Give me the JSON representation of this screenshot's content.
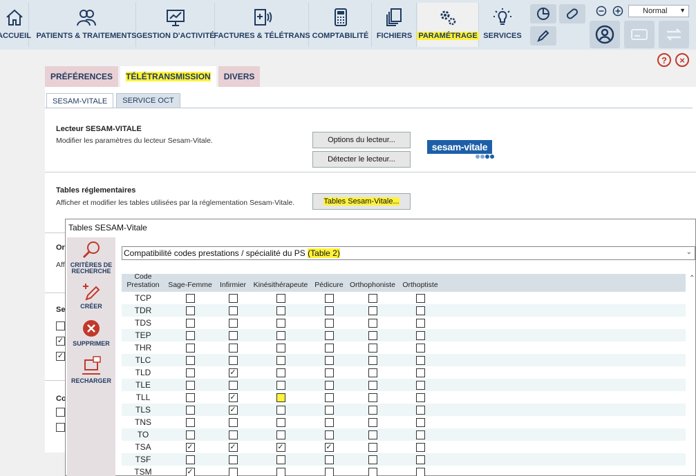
{
  "nav": {
    "items": [
      {
        "id": "accueil",
        "label": "ACCUEIL"
      },
      {
        "id": "patients",
        "label": "PATIENTS & TRAITEMENTS"
      },
      {
        "id": "gestion",
        "label": "GESTION D'ACTIVITÉ"
      },
      {
        "id": "factures",
        "label": "FACTURES & TÉLÉTRANS"
      },
      {
        "id": "comptabilite",
        "label": "COMPTABILITÉ"
      },
      {
        "id": "fichiers",
        "label": "FICHIERS"
      },
      {
        "id": "parametrage",
        "label": "PARAMÉTRAGE"
      },
      {
        "id": "services",
        "label": "SERVICES"
      }
    ],
    "mode": "Normal"
  },
  "tabs": {
    "main": [
      "PRÉFÉRENCES",
      "TÉLÉTRANSMISSION",
      "DIVERS"
    ],
    "sub": [
      "SESAM-VITALE",
      "SERVICE OCT"
    ]
  },
  "reader": {
    "title": "Lecteur SESAM-VITALE",
    "desc": "Modifier les paramètres du lecteur Sesam-Vitale.",
    "btn_options": "Options du lecteur...",
    "btn_detect": "Détecter le lecteur..."
  },
  "logo_text": "sesam-vitale",
  "tables": {
    "title": "Tables réglementaires",
    "desc": "Afficher et modifier les tables utilisées par la réglementation Sesam-Vitale.",
    "btn": "Tables Sesam-Vitale..."
  },
  "bg_partial": {
    "s1": "Or",
    "s1d": "Affi",
    "s2": "Se",
    "s3": "Co"
  },
  "dialog": {
    "title": "Tables SESAM-Vitale",
    "side": {
      "criteria": "CRITÈRES DE RECHERCHE",
      "create": "CRÉER",
      "delete": "SUPPRIMER",
      "reload": "RECHARGER"
    },
    "combo_prefix": "Compatibilité codes prestations / spécialité du PS",
    "combo_suffix": "(Table 2)"
  },
  "grid": {
    "headers": [
      "Code Prestation",
      "Sage-Femme",
      "Infirmier",
      "Kinésithérapeute",
      "Pédicure",
      "Orthophoniste",
      "Orthoptiste"
    ],
    "rows": [
      {
        "code": "TCP",
        "checks": [
          false,
          false,
          false,
          false,
          false,
          false
        ]
      },
      {
        "code": "TDR",
        "checks": [
          false,
          false,
          false,
          false,
          false,
          false
        ]
      },
      {
        "code": "TDS",
        "checks": [
          false,
          false,
          false,
          false,
          false,
          false
        ]
      },
      {
        "code": "TEP",
        "checks": [
          false,
          false,
          false,
          false,
          false,
          false
        ]
      },
      {
        "code": "THR",
        "checks": [
          false,
          false,
          false,
          false,
          false,
          false
        ]
      },
      {
        "code": "TLC",
        "checks": [
          false,
          false,
          false,
          false,
          false,
          false
        ]
      },
      {
        "code": "TLD",
        "checks": [
          false,
          true,
          false,
          false,
          false,
          false
        ]
      },
      {
        "code": "TLE",
        "checks": [
          false,
          false,
          false,
          false,
          false,
          false
        ]
      },
      {
        "code": "TLL",
        "checks": [
          false,
          true,
          false,
          false,
          false,
          false
        ],
        "highlight": 2
      },
      {
        "code": "TLS",
        "checks": [
          false,
          true,
          false,
          false,
          false,
          false
        ]
      },
      {
        "code": "TNS",
        "checks": [
          false,
          false,
          false,
          false,
          false,
          false
        ]
      },
      {
        "code": "TO",
        "checks": [
          false,
          false,
          false,
          false,
          false,
          false
        ]
      },
      {
        "code": "TSA",
        "checks": [
          true,
          true,
          true,
          true,
          false,
          false
        ]
      },
      {
        "code": "TSF",
        "checks": [
          false,
          false,
          false,
          false,
          false,
          false
        ]
      },
      {
        "code": "TSM",
        "checks": [
          true,
          false,
          false,
          false,
          false,
          false
        ]
      }
    ]
  }
}
